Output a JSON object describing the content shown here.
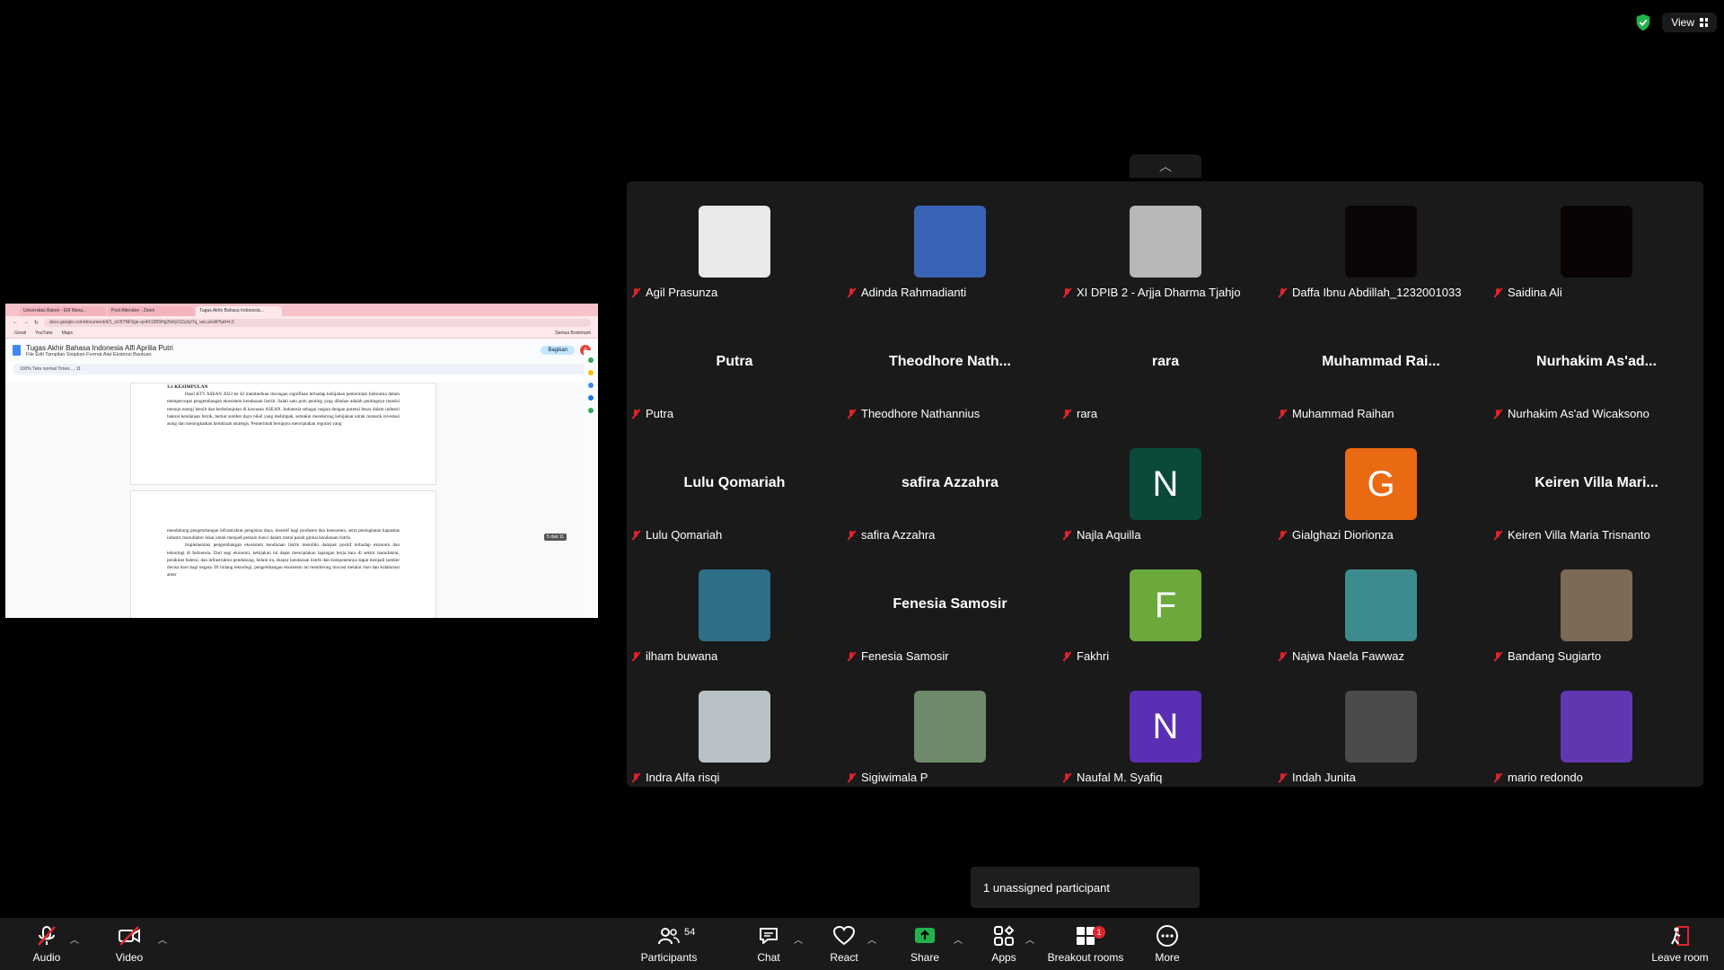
{
  "top": {
    "view_label": "View"
  },
  "share": {
    "tabs": [
      "Universitas Bakrie - EM Mana...",
      "Post Attendee - Zoom",
      "Tugas Akhir Bahasa Indonesia..."
    ],
    "url": "docs.google.com/document/d/1_eD5TNF6ge-qo4X1955Hg2fs6yOZa3yI7q_veLu/edit?tab=t.0",
    "bookmarks": [
      "Gmail",
      "YouTube",
      "Maps",
      "Semua Bookmark"
    ],
    "doc_title": "Tugas Akhir Bahasa Indonesia Alfi Aprilia Putri",
    "doc_menu": "File  Edit  Tampilan  Sisipkan  Format  Alat  Ekstensi  Bantuan",
    "share_button": "Bagikan",
    "toolbar_text": "100%   Teks normal   Times ...   11",
    "section_heading": "3.1 KESIMPULAN",
    "para1": "Hasil KTT ASEAN 2023 ke 42 memberikan dorongan signifikan terhadap kebijakan pemerintah Indonesia dalam mempercepat pengembangan ekosistem kendaraan listrik. Salah satu poin penting yang dibahas adalah pentingnya transisi menuju energi bersih dan berkelanjutan di kawasan ASEAN. Indonesia sebagai negara dengan potensi besar dalam industri baterai kendaraan listrik, berkat sumber daya nikel yang melimpah, semakin mendorong kebijakan untuk menarik investasi asing dan meningkatkan kemitraan strategis. Pemerintah berupaya menciptakan regulasi yang",
    "para2": "mendukung pengembangan infrastruktur pengisian daya, insentif bagi produsen dan konsumen, serta peningkatan kapasitas industri manufaktur lokal untuk menjadi pemain kunci dalam rantai pasok global kendaraan listrik.",
    "para3": "Implementasi pengembangan ekosistem kendaraan listrik memiliki dampak positif terhadap ekonomi dan teknologi di Indonesia. Dari segi ekonomi, kebijakan ini dapat menciptakan lapangan kerja baru di sektor manufaktur, perakitan baterai, dan infrastruktur pendukung. Selain itu, ekspor kendaraan listrik dan komponennya dapat menjadi sumber devisa baru bagi negara. Di bidang teknologi, pengembangan ekosistem ini mendorong inovasi melalui riset dan kolaborasi antar",
    "page_counter": "5 dari 11"
  },
  "participants": [
    {
      "name": "Agil Prasunza",
      "kind": "photo",
      "color": "#e9e9e9"
    },
    {
      "name": "Adinda Rahmadianti",
      "kind": "photo",
      "color": "#3b63b5"
    },
    {
      "name": "XI DPIB 2 - Arjja Dharma Tjahjo",
      "kind": "photo",
      "color": "#b8b8b8"
    },
    {
      "name": "Daffa Ibnu Abdillah_1232001033",
      "kind": "photo",
      "color": "#0a0508"
    },
    {
      "name": "Saidina Ali",
      "kind": "photo",
      "color": "#0a0306"
    },
    {
      "name": "Putra",
      "kind": "text",
      "big": "Putra"
    },
    {
      "name": "Theodhore Nathannius",
      "kind": "text",
      "big": "Theodhore  Nath..."
    },
    {
      "name": "rara",
      "kind": "text",
      "big": "rara"
    },
    {
      "name": "Muhammad Raihan",
      "kind": "text",
      "big": "Muhammad  Rai..."
    },
    {
      "name": "Nurhakim As'ad Wicaksono",
      "kind": "text",
      "big": "Nurhakim  As'ad..."
    },
    {
      "name": "Lulu  Qomariah",
      "kind": "text",
      "big": "Lulu  Qomariah"
    },
    {
      "name": "safira Azzahra",
      "kind": "text",
      "big": "safira Azzahra"
    },
    {
      "name": "Najla Aquilla",
      "kind": "letter",
      "letter": "N",
      "color": "#0b4a3a"
    },
    {
      "name": "Gialghazi Diorionza",
      "kind": "letter",
      "letter": "G",
      "color": "#e96a12"
    },
    {
      "name": "Keiren Villa Maria Trisnanto",
      "kind": "text",
      "big": "Keiren Villa Mari..."
    },
    {
      "name": "ilham buwana",
      "kind": "photo",
      "color": "#2c6f86"
    },
    {
      "name": "Fenesia Samosir",
      "kind": "text",
      "big": "Fenesia Samosir"
    },
    {
      "name": "Fakhri",
      "kind": "letter",
      "letter": "F",
      "color": "#6aa93a"
    },
    {
      "name": "Najwa Naela Fawwaz",
      "kind": "photo",
      "color": "#3c8c8e"
    },
    {
      "name": "Bandang Sugiarto",
      "kind": "photo",
      "color": "#7b6a55"
    },
    {
      "name": "Indra Alfa risqi",
      "kind": "photo",
      "color": "#b8c2c6"
    },
    {
      "name": "Sigiwimala P",
      "kind": "photo",
      "color": "#6e8a6a"
    },
    {
      "name": "Naufal M. Syafiq",
      "kind": "letter",
      "letter": "N",
      "color": "#5b2fb4"
    },
    {
      "name": "Indah Junita",
      "kind": "photo",
      "color": "#4b4b4b"
    },
    {
      "name": "mario redondo",
      "kind": "letter",
      "letter": "",
      "color": "#5f37b0"
    }
  ],
  "notice": "1 unassigned participant",
  "toolbar": {
    "audio": "Audio",
    "video": "Video",
    "participants": "Participants",
    "participants_count": "54",
    "chat": "Chat",
    "react": "React",
    "share": "Share",
    "apps": "Apps",
    "breakout": "Breakout rooms",
    "breakout_badge": "1",
    "more": "More",
    "leave": "Leave room"
  }
}
